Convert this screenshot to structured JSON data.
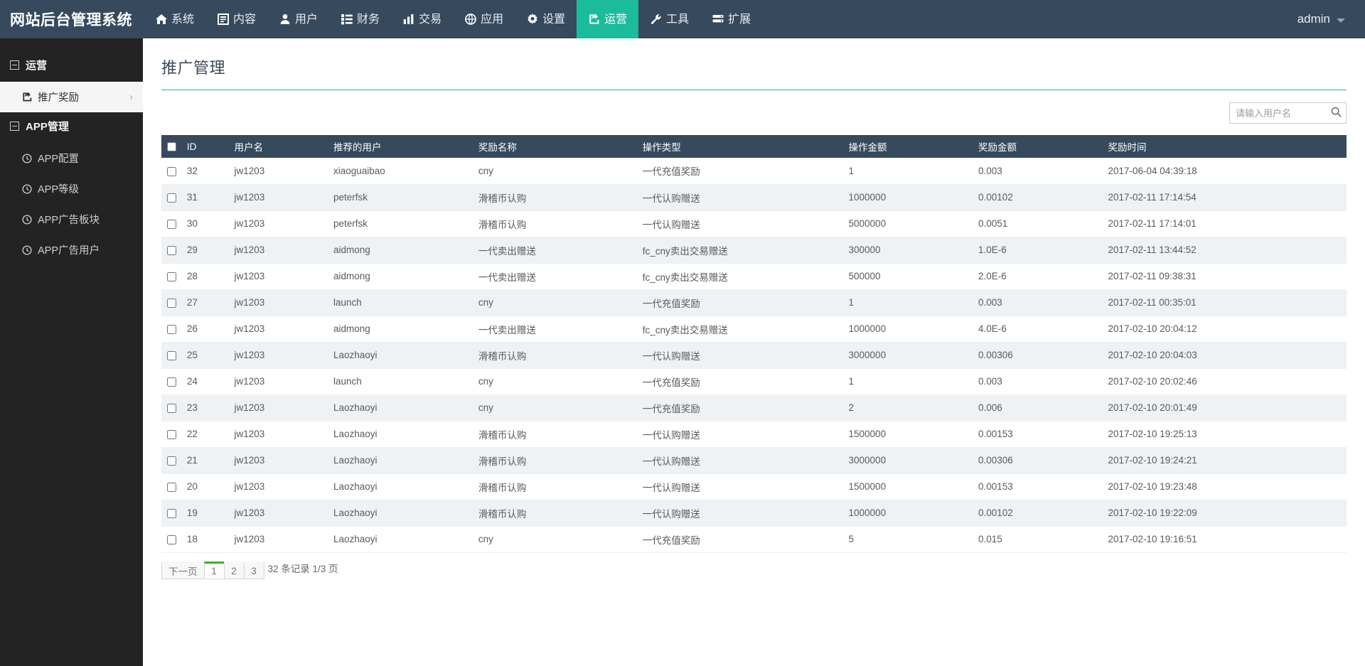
{
  "navbar": {
    "brand": "网站后台管理系统",
    "items": [
      {
        "label": "系统",
        "icon": "home-icon",
        "active": false
      },
      {
        "label": "内容",
        "icon": "document-icon",
        "active": false
      },
      {
        "label": "用户",
        "icon": "user-icon",
        "active": false
      },
      {
        "label": "财务",
        "icon": "list-icon",
        "active": false
      },
      {
        "label": "交易",
        "icon": "bar-chart-icon",
        "active": false
      },
      {
        "label": "应用",
        "icon": "globe-icon",
        "active": false
      },
      {
        "label": "设置",
        "icon": "gear-icon",
        "active": false
      },
      {
        "label": "运营",
        "icon": "share-icon",
        "active": true
      },
      {
        "label": "工具",
        "icon": "wrench-icon",
        "active": false
      },
      {
        "label": "扩展",
        "icon": "server-icon",
        "active": false
      }
    ],
    "user": "admin",
    "accent_color": "#1abc9c",
    "background_color": "#36495d"
  },
  "sidebar": {
    "groups": [
      {
        "title": "运营",
        "items": [
          {
            "label": "推广奖励",
            "icon": "share-icon",
            "active": true,
            "chevron": "›"
          }
        ]
      },
      {
        "title": "APP管理",
        "items": [
          {
            "label": "APP配置",
            "icon": "clock-icon",
            "active": false
          },
          {
            "label": "APP等级",
            "icon": "clock-icon",
            "active": false
          },
          {
            "label": "APP广告板块",
            "icon": "clock-icon",
            "active": false
          },
          {
            "label": "APP广告用户",
            "icon": "clock-icon",
            "active": false
          }
        ]
      }
    ]
  },
  "page": {
    "title": "推广管理"
  },
  "search": {
    "placeholder": "请输入用户名",
    "value": "",
    "icon": "search-icon"
  },
  "table": {
    "select_all_checked": false,
    "columns": [
      "ID",
      "用户名",
      "推荐的用户",
      "奖励名称",
      "操作类型",
      "操作金额",
      "奖励金额",
      "奖励时间"
    ],
    "rows": [
      {
        "id": "32",
        "user": "jw1203",
        "referred": "xiaoguaibao",
        "reward_name": "cny",
        "op_type": "一代充值奖励",
        "op_amount": "1",
        "reward_amount": "0.003",
        "reward_time": "2017-06-04 04:39:18"
      },
      {
        "id": "31",
        "user": "jw1203",
        "referred": "peterfsk",
        "reward_name": "滑稽币认购",
        "op_type": "一代认购赠送",
        "op_amount": "1000000",
        "reward_amount": "0.00102",
        "reward_time": "2017-02-11 17:14:54"
      },
      {
        "id": "30",
        "user": "jw1203",
        "referred": "peterfsk",
        "reward_name": "滑稽币认购",
        "op_type": "一代认购赠送",
        "op_amount": "5000000",
        "reward_amount": "0.0051",
        "reward_time": "2017-02-11 17:14:01"
      },
      {
        "id": "29",
        "user": "jw1203",
        "referred": "aidmong",
        "reward_name": "一代卖出赠送",
        "op_type": "fc_cny卖出交易赠送",
        "op_amount": "300000",
        "reward_amount": "1.0E-6",
        "reward_time": "2017-02-11 13:44:52"
      },
      {
        "id": "28",
        "user": "jw1203",
        "referred": "aidmong",
        "reward_name": "一代卖出赠送",
        "op_type": "fc_cny卖出交易赠送",
        "op_amount": "500000",
        "reward_amount": "2.0E-6",
        "reward_time": "2017-02-11 09:38:31"
      },
      {
        "id": "27",
        "user": "jw1203",
        "referred": "launch",
        "reward_name": "cny",
        "op_type": "一代充值奖励",
        "op_amount": "1",
        "reward_amount": "0.003",
        "reward_time": "2017-02-11 00:35:01"
      },
      {
        "id": "26",
        "user": "jw1203",
        "referred": "aidmong",
        "reward_name": "一代卖出赠送",
        "op_type": "fc_cny卖出交易赠送",
        "op_amount": "1000000",
        "reward_amount": "4.0E-6",
        "reward_time": "2017-02-10 20:04:12"
      },
      {
        "id": "25",
        "user": "jw1203",
        "referred": "Laozhaoyi",
        "reward_name": "滑稽币认购",
        "op_type": "一代认购赠送",
        "op_amount": "3000000",
        "reward_amount": "0.00306",
        "reward_time": "2017-02-10 20:04:03"
      },
      {
        "id": "24",
        "user": "jw1203",
        "referred": "launch",
        "reward_name": "cny",
        "op_type": "一代充值奖励",
        "op_amount": "1",
        "reward_amount": "0.003",
        "reward_time": "2017-02-10 20:02:46"
      },
      {
        "id": "23",
        "user": "jw1203",
        "referred": "Laozhaoyi",
        "reward_name": "cny",
        "op_type": "一代充值奖励",
        "op_amount": "2",
        "reward_amount": "0.006",
        "reward_time": "2017-02-10 20:01:49"
      },
      {
        "id": "22",
        "user": "jw1203",
        "referred": "Laozhaoyi",
        "reward_name": "滑稽币认购",
        "op_type": "一代认购赠送",
        "op_amount": "1500000",
        "reward_amount": "0.00153",
        "reward_time": "2017-02-10 19:25:13"
      },
      {
        "id": "21",
        "user": "jw1203",
        "referred": "Laozhaoyi",
        "reward_name": "滑稽币认购",
        "op_type": "一代认购赠送",
        "op_amount": "3000000",
        "reward_amount": "0.00306",
        "reward_time": "2017-02-10 19:24:21"
      },
      {
        "id": "20",
        "user": "jw1203",
        "referred": "Laozhaoyi",
        "reward_name": "滑稽币认购",
        "op_type": "一代认购赠送",
        "op_amount": "1500000",
        "reward_amount": "0.00153",
        "reward_time": "2017-02-10 19:23:48"
      },
      {
        "id": "19",
        "user": "jw1203",
        "referred": "Laozhaoyi",
        "reward_name": "滑稽币认购",
        "op_type": "一代认购赠送",
        "op_amount": "1000000",
        "reward_amount": "0.00102",
        "reward_time": "2017-02-10 19:22:09"
      },
      {
        "id": "18",
        "user": "jw1203",
        "referred": "Laozhaoyi",
        "reward_name": "cny",
        "op_type": "一代充值奖励",
        "op_amount": "5",
        "reward_amount": "0.015",
        "reward_time": "2017-02-10 19:16:51"
      }
    ]
  },
  "pagination": {
    "next_label": "下一页",
    "pages": [
      "1",
      "2",
      "3"
    ],
    "active_page": "1",
    "active_color": "#3fae29",
    "info": "32 条记录 1/3 页"
  }
}
